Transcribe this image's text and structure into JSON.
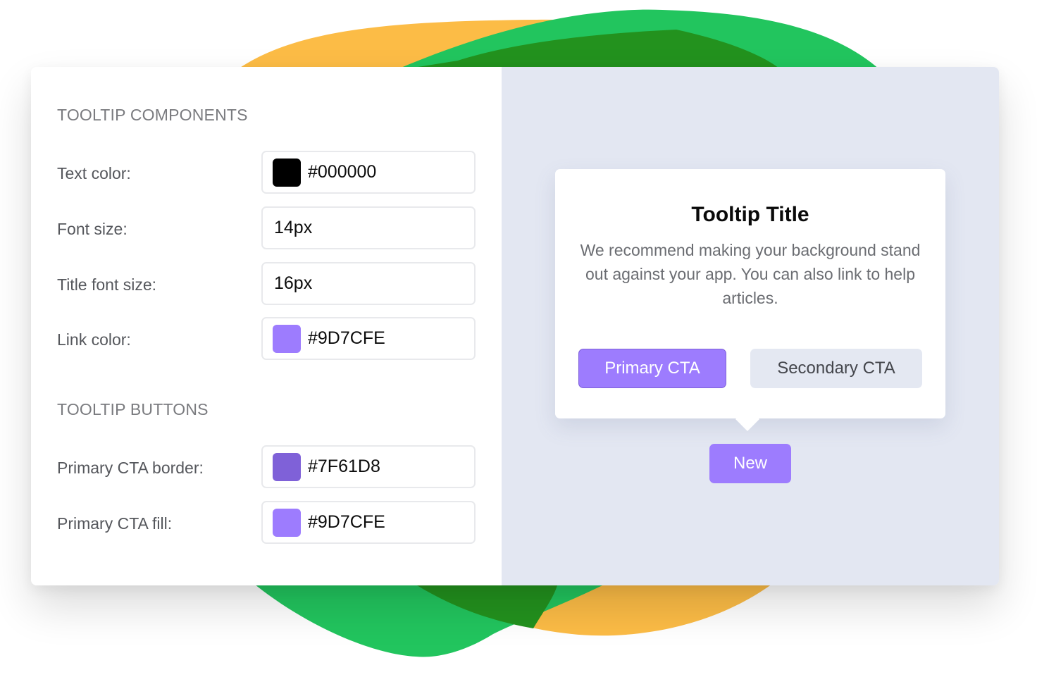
{
  "colors": {
    "blob_yellow": "#fcbc46",
    "blob_green": "#22c55e",
    "blob_overlap": "#23921e",
    "panel_bg": "#e3e7f2",
    "primary_fill": "#9d7cfe",
    "primary_border": "#7f61d8",
    "secondary_fill": "#e4e8f2"
  },
  "settings": {
    "components_title": "TOOLTIP COMPONENTS",
    "components": [
      {
        "label": "Text color:",
        "value": "#000000",
        "swatch": "#000000"
      },
      {
        "label": "Font size:",
        "value": "14px",
        "swatch": null
      },
      {
        "label": "Title font size:",
        "value": "16px",
        "swatch": null
      },
      {
        "label": "Link color:",
        "value": "#9D7CFE",
        "swatch": "#9D7CFE"
      }
    ],
    "buttons_title": "TOOLTIP BUTTONS",
    "buttons": [
      {
        "label": "Primary CTA border:",
        "value": "#7F61D8",
        "swatch": "#7F61D8"
      },
      {
        "label": "Primary CTA fill:",
        "value": "#9D7CFE",
        "swatch": "#9D7CFE"
      }
    ]
  },
  "preview": {
    "tooltip_title": "Tooltip Title",
    "tooltip_body": "We recommend making your background stand out against your app. You can also link to help articles.",
    "primary_cta": "Primary CTA",
    "secondary_cta": "Secondary CTA",
    "beacon_label": "New"
  }
}
